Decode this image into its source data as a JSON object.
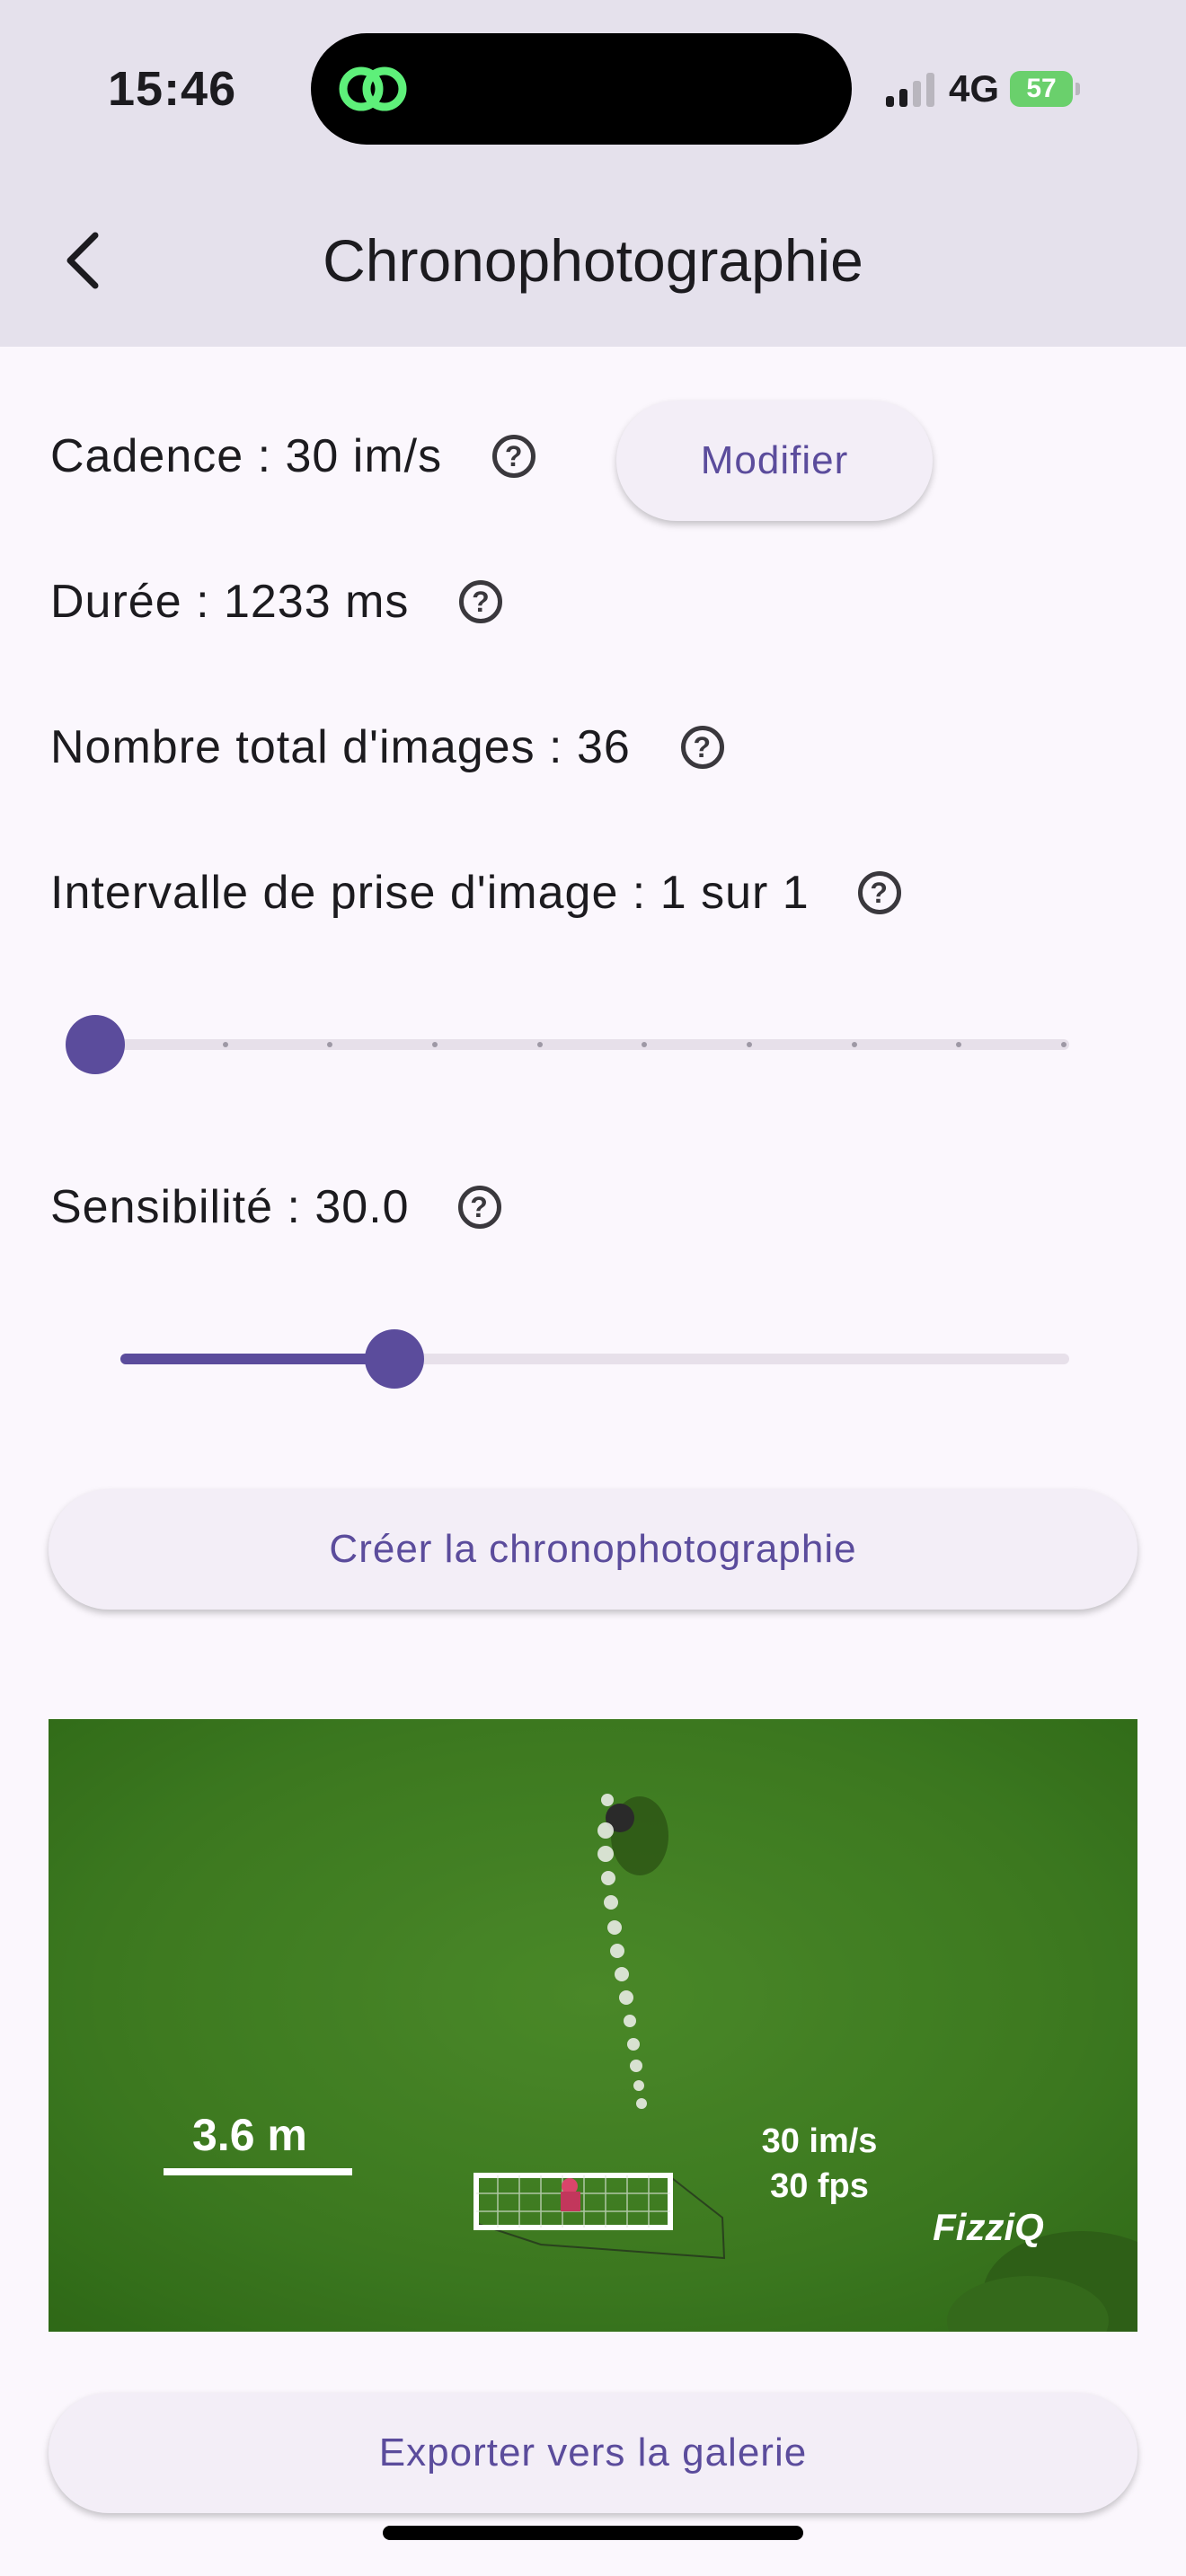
{
  "status_bar": {
    "time": "15:46",
    "network": "4G",
    "battery": "57"
  },
  "app_bar": {
    "title": "Chronophotographie"
  },
  "settings": {
    "cadence": "Cadence : 30 im/s",
    "modify_label": "Modifier",
    "duree": "Durée : 1233 ms",
    "total_images": "Nombre total d'images : 36",
    "interval": "Intervalle de prise d'image : 1 sur 1",
    "interval_slider_value": 1,
    "interval_slider_max": 10,
    "sensibilite": "Sensibilité : 30.0",
    "sensibilite_slider_fraction": 0.29
  },
  "actions": {
    "create_label": "Créer la chronophotographie",
    "export_label": "Exporter vers la galerie"
  },
  "photo": {
    "scale_label": "3.6 m",
    "rate_line1": "30 im/s",
    "rate_line2": "30 fps",
    "brand": "FizziQ"
  },
  "colors": {
    "accent": "#5b4c9c",
    "header_bg": "#e5e1ec",
    "page_bg": "#fbf7fd",
    "battery": "#6ad06c"
  },
  "icons": [
    "back-arrow-icon",
    "help-icon",
    "signal-icon",
    "battery-icon",
    "app-link-icon"
  ]
}
